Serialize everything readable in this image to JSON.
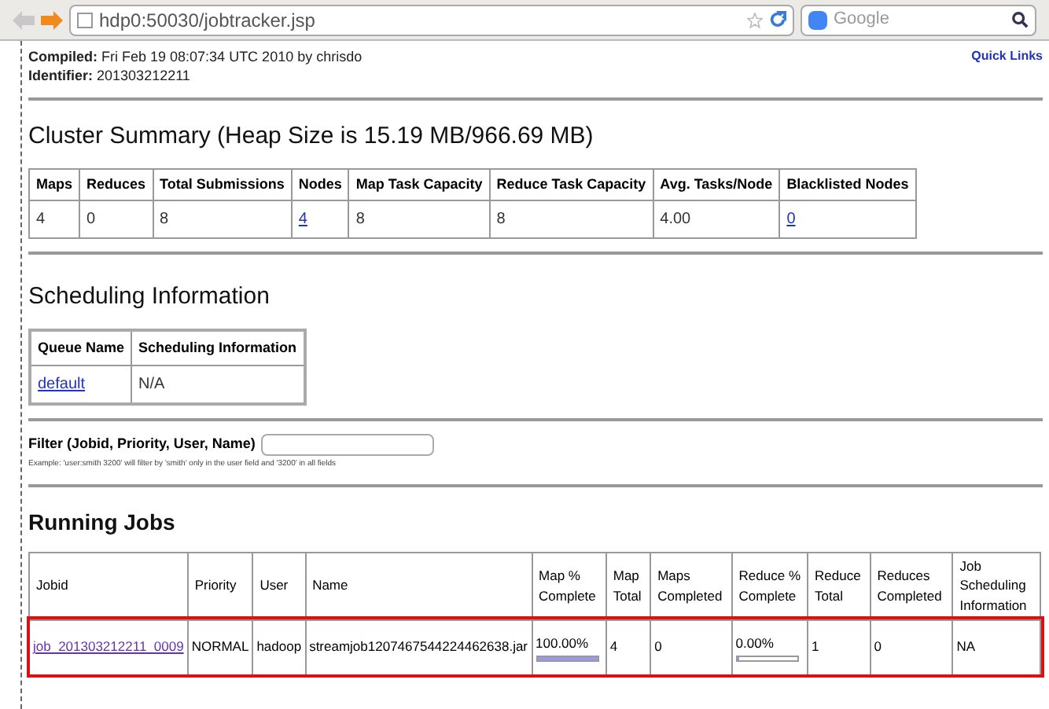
{
  "browser": {
    "address": "hdp0:50030/jobtracker.jsp",
    "search_placeholder": "Google"
  },
  "header": {
    "compiled_label": "Compiled:",
    "compiled": "Fri Feb 19 08:07:34 UTC 2010 by chrisdo",
    "identifier_label": "Identifier:",
    "identifier": "201303212211",
    "quick_links": "Quick Links"
  },
  "cluster_summary": {
    "title": "Cluster Summary (Heap Size is 15.19 MB/966.69 MB)",
    "columns": [
      "Maps",
      "Reduces",
      "Total Submissions",
      "Nodes",
      "Map Task Capacity",
      "Reduce Task Capacity",
      "Avg. Tasks/Node",
      "Blacklisted Nodes"
    ],
    "row": [
      {
        "text": "4",
        "link": false
      },
      {
        "text": "0",
        "link": false
      },
      {
        "text": "8",
        "link": false
      },
      {
        "text": "4",
        "link": true
      },
      {
        "text": "8",
        "link": false
      },
      {
        "text": "8",
        "link": false
      },
      {
        "text": "4.00",
        "link": false
      },
      {
        "text": "0",
        "link": true
      }
    ]
  },
  "scheduling": {
    "title": "Scheduling Information",
    "columns": [
      "Queue Name",
      "Scheduling Information"
    ],
    "row": [
      {
        "text": "default",
        "link": true
      },
      {
        "text": "N/A",
        "link": false
      }
    ]
  },
  "filter": {
    "label": "Filter (Jobid, Priority, User, Name)",
    "example": "Example: 'user:smith 3200' will filter by 'smith' only in the user field and '3200' in all fields"
  },
  "running_jobs": {
    "title": "Running Jobs",
    "columns": [
      "Jobid",
      "Priority",
      "User",
      "Name",
      "Map % Complete",
      "Map Total",
      "Maps Completed",
      "Reduce % Complete",
      "Reduce Total",
      "Reduces Completed",
      "Job Scheduling Information"
    ],
    "rows": [
      {
        "highlighted": true,
        "cells": [
          {
            "kind": "link",
            "text": "job_201303212211_0009"
          },
          {
            "kind": "text",
            "text": "NORMAL"
          },
          {
            "kind": "text",
            "text": "hadoop"
          },
          {
            "kind": "text",
            "text": "streamjob1207467544224462638.jar"
          },
          {
            "kind": "progress",
            "text": "100.00%",
            "level": 1
          },
          {
            "kind": "text",
            "text": "4"
          },
          {
            "kind": "text",
            "text": "0"
          },
          {
            "kind": "progress",
            "text": "0.00%",
            "level": 0
          },
          {
            "kind": "text",
            "text": "1"
          },
          {
            "kind": "text",
            "text": "0"
          },
          {
            "kind": "text",
            "text": "NA"
          }
        ]
      }
    ]
  }
}
